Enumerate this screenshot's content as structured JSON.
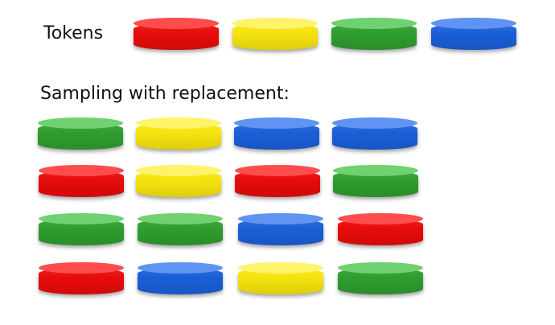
{
  "labels": {
    "tokens": "Tokens",
    "sampling": "Sampling with replacement:"
  },
  "colors": {
    "red": {
      "top": "#ff4d4d",
      "mid": "#e80b0b"
    },
    "yellow": {
      "top": "#fff36a",
      "mid": "#f6e40e"
    },
    "green": {
      "top": "#6fd16f",
      "mid": "#2f9d2f"
    },
    "blue": {
      "top": "#5f94f2",
      "mid": "#1a5fd8"
    }
  },
  "tokens": [
    "red",
    "yellow",
    "green",
    "blue"
  ],
  "samples": [
    [
      "green",
      "yellow",
      "blue",
      "blue"
    ],
    [
      "red",
      "yellow",
      "red",
      "green"
    ],
    [
      "green",
      "green",
      "blue",
      "red"
    ],
    [
      "red",
      "blue",
      "yellow",
      "green"
    ]
  ]
}
